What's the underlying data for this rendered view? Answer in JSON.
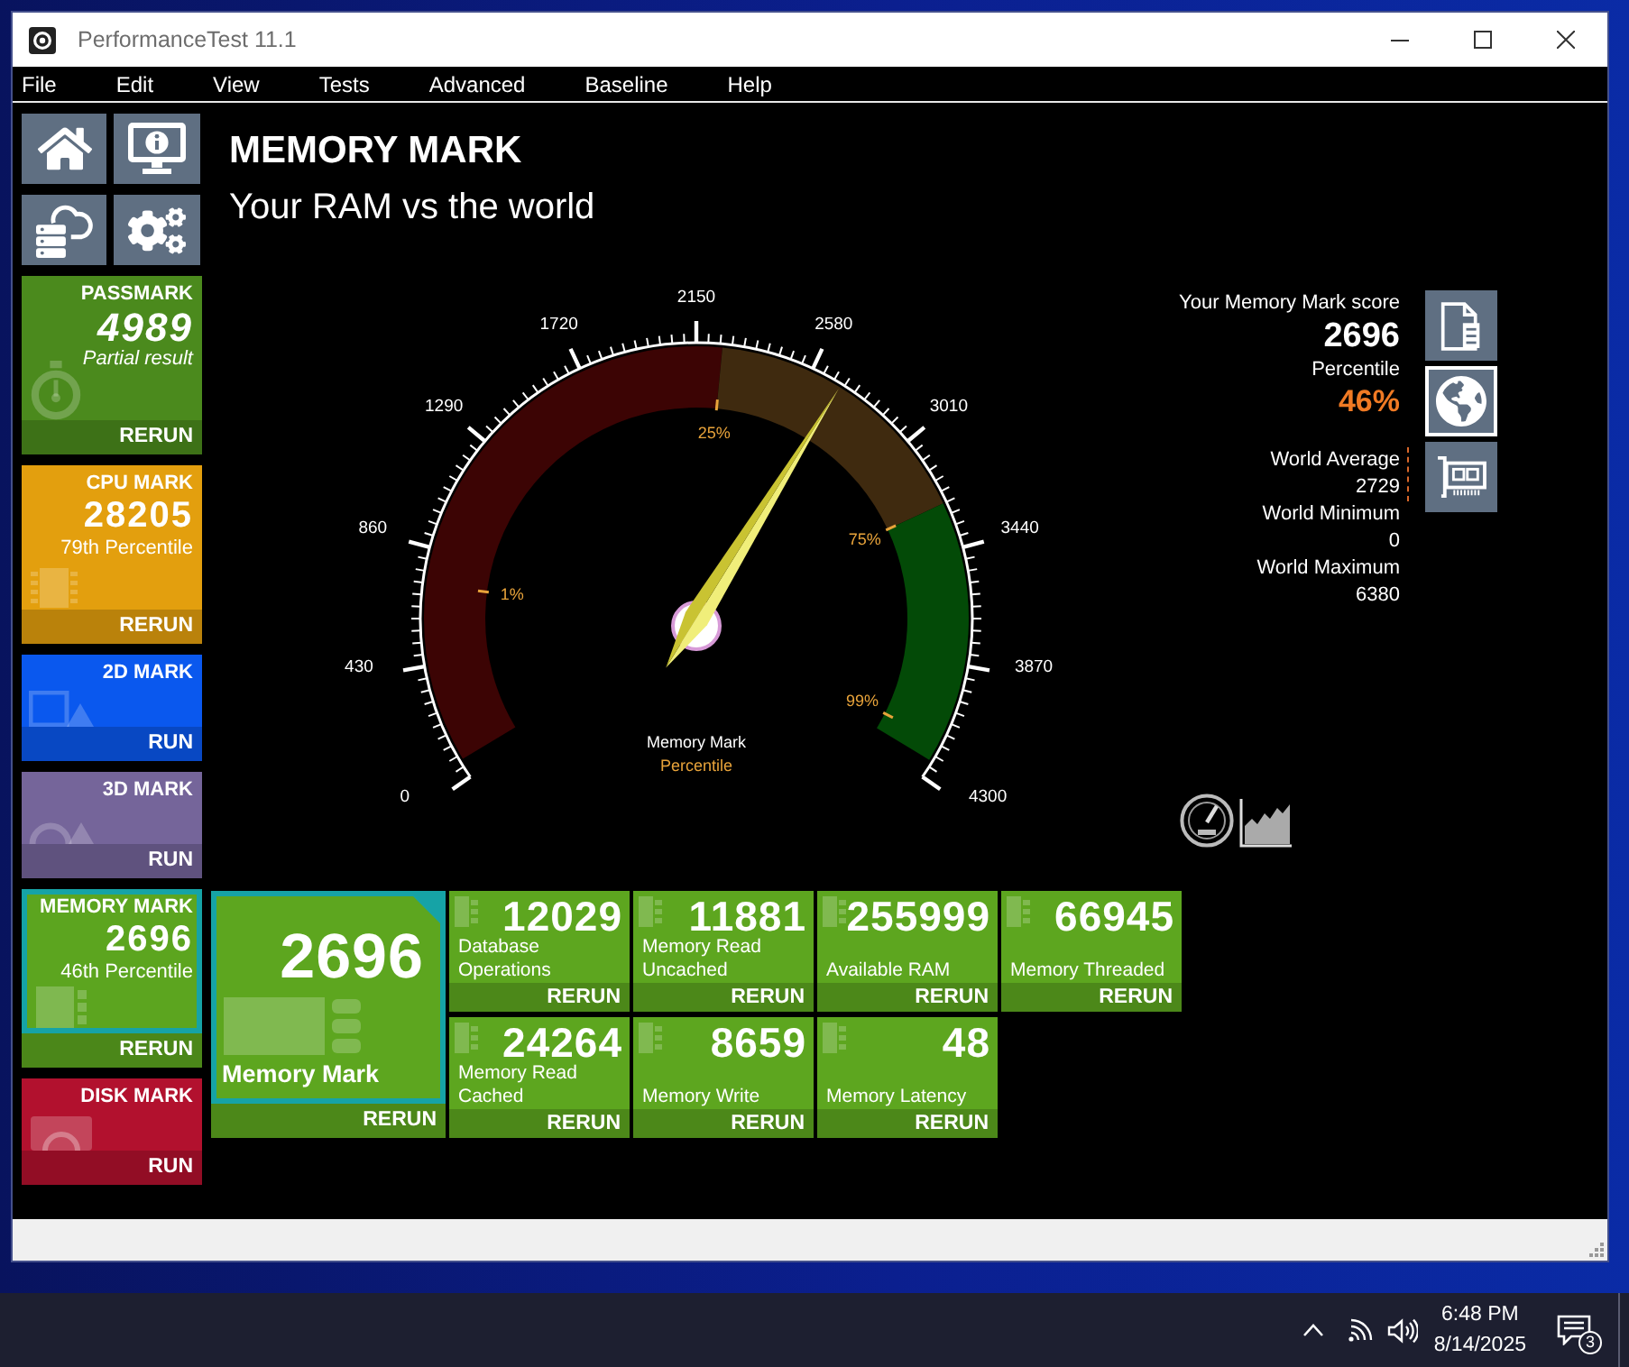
{
  "window": {
    "title": "PerformanceTest 11.1"
  },
  "menu": [
    "File",
    "Edit",
    "View",
    "Tests",
    "Advanced",
    "Baseline",
    "Help"
  ],
  "sidebar": [
    {
      "kind": "passmark",
      "title": "PASSMARK",
      "score": "4989",
      "note": "Partial result",
      "action": "RERUN",
      "color": "#4b8a1d",
      "selected": false
    },
    {
      "kind": "cpu",
      "title": "CPU MARK",
      "score": "28205",
      "note": "79th Percentile",
      "action": "RERUN",
      "color": "#e39f0e",
      "selected": false
    },
    {
      "kind": "graphics",
      "title": "2D MARK",
      "action": "RUN",
      "color": "#0a58ee",
      "selected": false
    },
    {
      "kind": "scene",
      "title": "3D MARK",
      "action": "RUN",
      "color": "#75659a",
      "selected": false
    },
    {
      "kind": "memory",
      "title": "MEMORY MARK",
      "score": "2696",
      "note": "46th Percentile",
      "action": "RERUN",
      "color": "#5ca51f",
      "selected": true
    },
    {
      "kind": "disk",
      "title": "DISK MARK",
      "action": "RUN",
      "color": "#b2112e",
      "selected": false
    }
  ],
  "header": {
    "title": "MEMORY MARK",
    "subtitle": "Your RAM vs the world"
  },
  "gauge": {
    "scale": [
      "0",
      "430",
      "860",
      "1290",
      "1720",
      "2150",
      "2580",
      "3010",
      "3440",
      "3870",
      "4300"
    ],
    "marks": [
      "1%",
      "25%",
      "75%",
      "99%"
    ],
    "caption": "Memory Mark",
    "subcaption": "Percentile",
    "level": 0.627
  },
  "summary": {
    "score_label": "Your Memory Mark score",
    "score": "2696",
    "percentile_label": "Percentile",
    "percentile": "46%",
    "stats": [
      {
        "label": "World Average",
        "value": "2729",
        "marked": true
      },
      {
        "label": "World Minimum",
        "value": "0",
        "marked": false
      },
      {
        "label": "World Maximum",
        "value": "6380",
        "marked": false
      }
    ]
  },
  "view_buttons": [
    {
      "kind": "report",
      "selected": false
    },
    {
      "kind": "globe",
      "selected": true
    },
    {
      "kind": "hardware",
      "selected": false
    }
  ],
  "main_result": {
    "score": "2696",
    "label": "Memory Mark",
    "action": "RERUN"
  },
  "results": [
    {
      "score": "12029",
      "label": "Database Operations",
      "action": "RERUN"
    },
    {
      "score": "11881",
      "label": "Memory Read Uncached",
      "action": "RERUN"
    },
    {
      "score": "255999",
      "label": "Available RAM",
      "action": "RERUN"
    },
    {
      "score": "66945",
      "label": "Memory Threaded",
      "action": "RERUN"
    },
    {
      "score": "24264",
      "label": "Memory Read Cached",
      "action": "RERUN"
    },
    {
      "score": "8659",
      "label": "Memory Write",
      "action": "RERUN"
    },
    {
      "score": "48",
      "label": "Memory Latency",
      "action": "RERUN"
    }
  ],
  "taskbar": {
    "time": "6:48 PM",
    "date": "8/14/2025",
    "notifications": "3"
  }
}
